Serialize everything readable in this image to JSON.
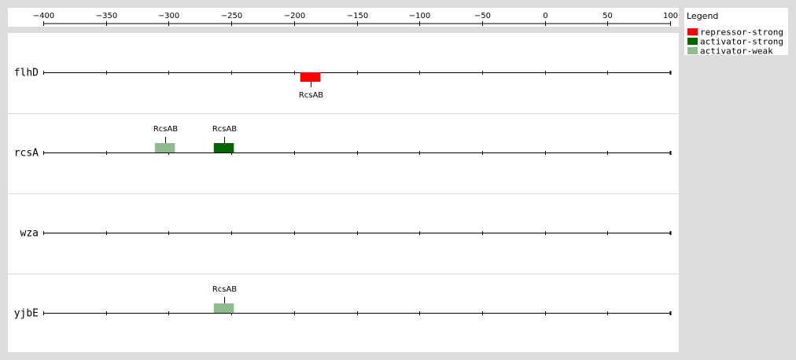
{
  "axis": {
    "ticks": [
      -400,
      -350,
      -300,
      -250,
      -200,
      -150,
      -100,
      -50,
      0,
      50,
      100
    ],
    "tick_labels": [
      "−400",
      "−350",
      "−300",
      "−250",
      "−200",
      "−150",
      "−100",
      "−50",
      "0",
      "50",
      "100"
    ],
    "range": [
      -400,
      100
    ]
  },
  "legend": {
    "title": "Legend",
    "items": [
      {
        "label": "repressor-strong",
        "color": "#ff0000"
      },
      {
        "label": "activator-strong",
        "color": "#006400"
      },
      {
        "label": "activator-weak",
        "color": "#8fbc8f"
      }
    ]
  },
  "rows": [
    {
      "gene": "flhD",
      "sites": [
        {
          "label": "RcsAB",
          "start": -195,
          "end": -179,
          "type": "repressor-strong",
          "label_side": "below"
        }
      ]
    },
    {
      "gene": "rcsA",
      "sites": [
        {
          "label": "RcsAB",
          "start": -311,
          "end": -295,
          "type": "activator-weak",
          "label_side": "above"
        },
        {
          "label": "RcsAB",
          "start": -264,
          "end": -248,
          "type": "activator-strong",
          "label_side": "above"
        }
      ]
    },
    {
      "gene": "wza",
      "sites": []
    },
    {
      "gene": "yjbE",
      "sites": [
        {
          "label": "RcsAB",
          "start": -264,
          "end": -248,
          "type": "activator-weak",
          "label_side": "above"
        }
      ]
    }
  ]
}
